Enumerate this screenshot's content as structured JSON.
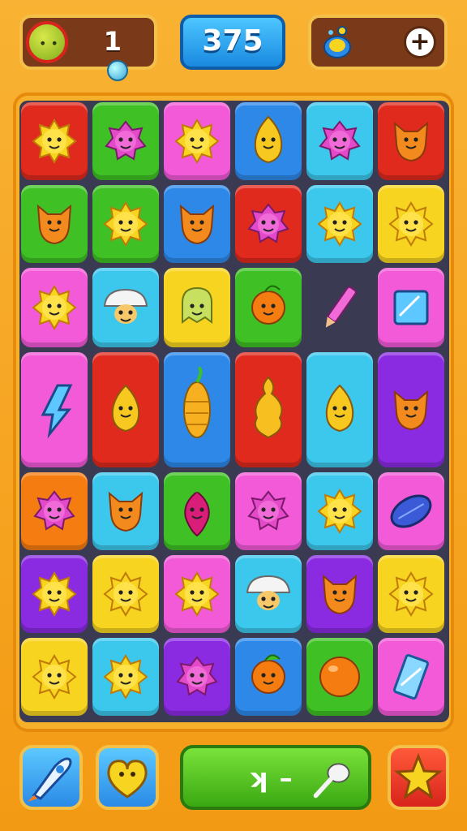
{
  "hud": {
    "level": "1",
    "score": "375",
    "left_icon": "monster-face-icon",
    "left_badge_icon": "bubble-icon",
    "right_icon": "potion-bag-icon",
    "add_icon": "plus-icon"
  },
  "colors": {
    "red": "#e02a1e",
    "green": "#3fc025",
    "pink": "#f25ad8",
    "blue": "#2d88e8",
    "cyan": "#3cc7ec",
    "yellow": "#f7d420",
    "purple": "#8a2be2",
    "orange": "#f57c10",
    "dark": "#3a3a52"
  },
  "board": {
    "rows": [
      [
        {
          "c": "red",
          "i": "sun-face"
        },
        {
          "c": "green",
          "i": "spiky-blob"
        },
        {
          "c": "pink",
          "i": "sun-face"
        },
        {
          "c": "blue",
          "i": "flame-face"
        },
        {
          "c": "cyan",
          "i": "spiky-blob"
        },
        {
          "c": "red",
          "i": "cat-face"
        }
      ],
      [
        {
          "c": "green",
          "i": "cat-face"
        },
        {
          "c": "green",
          "i": "sun-face"
        },
        {
          "c": "blue",
          "i": "cat-face"
        },
        {
          "c": "red",
          "i": "spiky-blob"
        },
        {
          "c": "cyan",
          "i": "sun-face"
        },
        {
          "c": "yellow",
          "i": "sun-face"
        }
      ],
      [
        {
          "c": "pink",
          "i": "sun-face"
        },
        {
          "c": "cyan",
          "i": "mushroom"
        },
        {
          "c": "yellow",
          "i": "ghost-face"
        },
        {
          "c": "green",
          "i": "fruit-face"
        },
        {
          "c": "dark",
          "i": "pencil"
        },
        {
          "c": "pink",
          "i": "square-gem"
        }
      ],
      [
        {
          "c": "pink",
          "i": "rune"
        },
        {
          "c": "red",
          "i": "flame-face"
        },
        {
          "c": "blue",
          "i": "corn"
        },
        {
          "c": "red",
          "i": "drill-shell"
        },
        {
          "c": "cyan",
          "i": "flame-face"
        },
        {
          "c": "purple",
          "i": "cat-face"
        }
      ],
      [
        {
          "c": "orange",
          "i": "spiky-blob"
        },
        {
          "c": "cyan",
          "i": "cat-face"
        },
        {
          "c": "green",
          "i": "radish"
        },
        {
          "c": "pink",
          "i": "spiky-blob"
        },
        {
          "c": "cyan",
          "i": "sun-face"
        },
        {
          "c": "pink",
          "i": "leaf-gem"
        }
      ],
      [
        {
          "c": "purple",
          "i": "sun-face"
        },
        {
          "c": "yellow",
          "i": "sun-face"
        },
        {
          "c": "pink",
          "i": "sun-face"
        },
        {
          "c": "cyan",
          "i": "mushroom"
        },
        {
          "c": "purple",
          "i": "cat-face"
        },
        {
          "c": "yellow",
          "i": "sun-face"
        }
      ],
      [
        {
          "c": "yellow",
          "i": "sun-face"
        },
        {
          "c": "cyan",
          "i": "sun-face"
        },
        {
          "c": "purple",
          "i": "spiky-blob"
        },
        {
          "c": "blue",
          "i": "fruit-face"
        },
        {
          "c": "green",
          "i": "orb"
        },
        {
          "c": "pink",
          "i": "crystal"
        }
      ]
    ]
  },
  "buttons": {
    "rocket_icon": "rocket-icon",
    "heart_icon": "heart-icon",
    "go_glyph": "ʞ –",
    "go_icon": "spoon-icon",
    "star_icon": "star-icon"
  }
}
